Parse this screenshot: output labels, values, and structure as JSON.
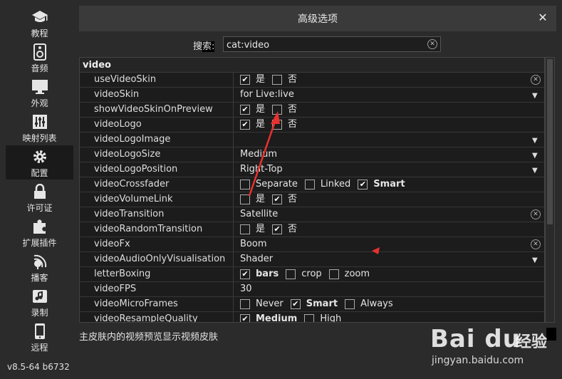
{
  "sidebar": {
    "items": [
      {
        "label": "教程",
        "icon": "graduation-cap-icon"
      },
      {
        "label": "音频",
        "icon": "speaker-icon"
      },
      {
        "label": "外观",
        "icon": "monitor-icon"
      },
      {
        "label": "映射列表",
        "icon": "equalizer-icon"
      },
      {
        "label": "配置",
        "icon": "gear-icon"
      },
      {
        "label": "许可证",
        "icon": "lock-icon"
      },
      {
        "label": "扩展插件",
        "icon": "puzzle-icon"
      },
      {
        "label": "播客",
        "icon": "broadcast-icon"
      },
      {
        "label": "录制",
        "icon": "music-note-icon"
      },
      {
        "label": "远程",
        "icon": "phone-icon"
      }
    ],
    "active_index": 4,
    "version": "v8.5-64 b6732"
  },
  "dialog": {
    "title": "高级选项",
    "close_glyph": "✕",
    "search_label_prefix": "搜",
    "search_label_highlight": "索:",
    "search_value": "cat:video",
    "group": "video",
    "description": "主皮肤内的视频预览显示视频皮肤"
  },
  "rows": {
    "r0": {
      "name": "useVideoSkin",
      "o1": "是",
      "o2": "否"
    },
    "r1": {
      "name": "videoSkin",
      "value": "for Live:live"
    },
    "r2": {
      "name": "showVideoSkinOnPreview",
      "o1": "是",
      "o2": "否"
    },
    "r3": {
      "name": "videoLogo",
      "o1": "是",
      "o2": "否"
    },
    "r4": {
      "name": "videoLogoImage",
      "value": ""
    },
    "r5": {
      "name": "videoLogoSize",
      "value": "Medium"
    },
    "r6": {
      "name": "videoLogoPosition",
      "value": "Right-Top"
    },
    "r7": {
      "name": "videoCrossfader",
      "o1": "Separate",
      "o2": "Linked",
      "o3": "Smart"
    },
    "r8": {
      "name": "videoVolumeLink",
      "o1": "是",
      "o2": "否"
    },
    "r9": {
      "name": "videoTransition",
      "value": "Satellite"
    },
    "r10": {
      "name": "videoRandomTransition",
      "o1": "是",
      "o2": "否"
    },
    "r11": {
      "name": "videoFx",
      "value": "Boom"
    },
    "r12": {
      "name": "videoAudioOnlyVisualisation",
      "value": "Shader"
    },
    "r13": {
      "name": "letterBoxing",
      "o1": "bars",
      "o2": "crop",
      "o3": "zoom"
    },
    "r14": {
      "name": "videoFPS",
      "value": "30"
    },
    "r15": {
      "name": "videoMicroFrames",
      "o1": "Never",
      "o2": "Smart",
      "o3": "Always"
    },
    "r16": {
      "name": "videoResampleQuality",
      "o1": "Medium",
      "o2": "High"
    }
  },
  "checkbox_states": {
    "useVideoSkin": [
      true,
      false
    ],
    "showVideoSkinOnPreview": [
      true,
      false
    ],
    "videoLogo": [
      true,
      false
    ],
    "videoCrossfader": [
      false,
      false,
      true
    ],
    "videoVolumeLink": [
      false,
      true
    ],
    "videoRandomTransition": [
      false,
      true
    ],
    "letterBoxing": [
      true,
      false,
      false
    ],
    "videoMicroFrames": [
      false,
      true,
      false
    ],
    "videoResampleQuality": [
      true,
      false
    ]
  },
  "scroll_position": 0,
  "watermark": {
    "brand": "Bai du",
    "sub": "经验",
    "url": "jingyan.baidu.com"
  },
  "colors": {
    "background": "#2b2b2b",
    "table_bg": "#1c1c1c",
    "annotation_red": "#e8312f"
  }
}
